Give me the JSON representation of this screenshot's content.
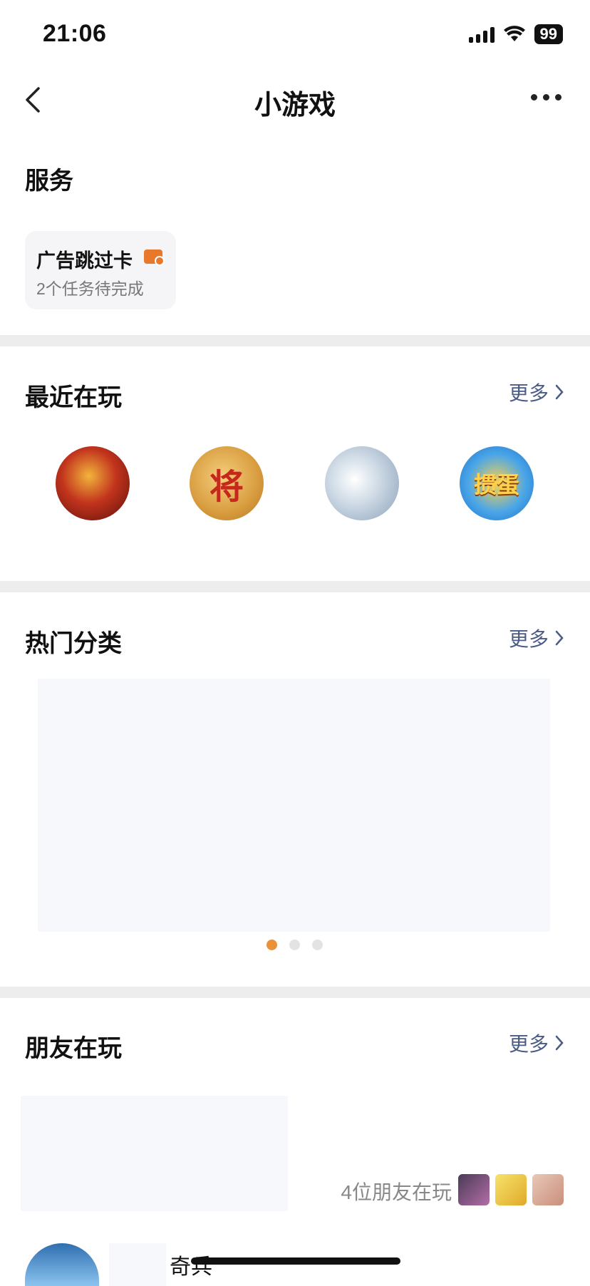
{
  "status_bar": {
    "time": "21:06",
    "battery": "99"
  },
  "nav": {
    "title": "小游戏"
  },
  "services": {
    "title": "服务",
    "card": {
      "name": "广告跳过卡",
      "subtitle": "2个任务待完成"
    }
  },
  "recent": {
    "title": "最近在玩",
    "more": "更多",
    "games": [
      {
        "icon": "monkey-king-game-icon"
      },
      {
        "icon": "chinese-chess-game-icon",
        "glyph": "将"
      },
      {
        "icon": "cartoon-girl-game-icon"
      },
      {
        "icon": "guandan-card-game-icon",
        "glyph": "掼蛋"
      }
    ]
  },
  "hot": {
    "title": "热门分类",
    "more": "更多",
    "pagination": {
      "pages": 3,
      "active": 1
    }
  },
  "friends": {
    "title": "朋友在玩",
    "more": "更多",
    "count_text": "4位朋友在玩",
    "game_name": "奇兵"
  },
  "colors": {
    "accent": "#e8923a",
    "link": "#4a5b86",
    "divider": "#ededed"
  }
}
